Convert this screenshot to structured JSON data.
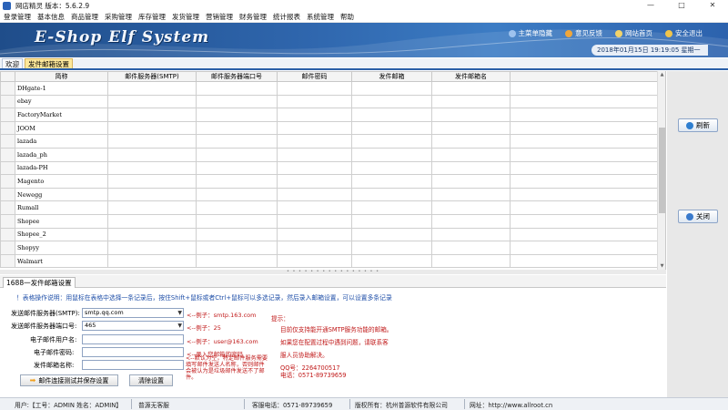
{
  "window": {
    "title": "网店精灵  版本：5.6.2.9",
    "min": "—",
    "max": "□",
    "close": "✕"
  },
  "menu": [
    "登录管理",
    "基本信息",
    "商品管理",
    "采购管理",
    "库存管理",
    "发货管理",
    "营销管理",
    "财务管理",
    "统计报表",
    "系统管理",
    "帮助"
  ],
  "banner": {
    "logo": "E-Shop Elf System",
    "links": [
      "主菜单隐藏",
      "意见反馈",
      "网站首页",
      "安全退出"
    ],
    "datetime": "2018年01月15日 19:19:05 星期一"
  },
  "tabs": [
    "欢迎",
    "发件邮箱设置"
  ],
  "grid": {
    "headers": [
      "简称",
      "邮件服务器(SMTP)",
      "邮件服务器端口号",
      "邮件密码",
      "发件邮箱",
      "发件邮箱名"
    ],
    "rows": [
      [
        "DHgate-1",
        "",
        "",
        "",
        "",
        ""
      ],
      [
        "ebay",
        "",
        "",
        "",
        "",
        ""
      ],
      [
        "FactoryMarket",
        "",
        "",
        "",
        "",
        ""
      ],
      [
        "JOOM",
        "",
        "",
        "",
        "",
        ""
      ],
      [
        "lazada",
        "",
        "",
        "",
        "",
        ""
      ],
      [
        "lazada_ph",
        "",
        "",
        "",
        "",
        ""
      ],
      [
        "lazada-PH",
        "",
        "",
        "",
        "",
        ""
      ],
      [
        "Magento",
        "",
        "",
        "",
        "",
        ""
      ],
      [
        "Newegg",
        "",
        "",
        "",
        "",
        ""
      ],
      [
        "Rumall",
        "",
        "",
        "",
        "",
        ""
      ],
      [
        "Shopee",
        "",
        "",
        "",
        "",
        ""
      ],
      [
        "Shopee_2",
        "",
        "",
        "",
        "",
        ""
      ],
      [
        "Shopyy",
        "",
        "",
        "",
        "",
        ""
      ],
      [
        "Walmart",
        "",
        "",
        "",
        "",
        ""
      ]
    ]
  },
  "side": {
    "refresh": "刷新",
    "close": "关闭"
  },
  "form_tab": "1688一发件邮箱设置",
  "form": {
    "hint": "！表格操作说明：用鼠标在表格中选择一条记录后，按住Shift+鼠标或者Ctrl+鼠标可以多选记录，然后录入邮箱设置，可以设置多条记录",
    "smtp_label": "发送邮件服务器(SMTP):",
    "smtp_value": "smtp.qq.com",
    "smtp_example": "<--例子：smtp.163.com",
    "port_label": "发送邮件服务器端口号:",
    "port_value": "465",
    "port_example": "<--例子：25",
    "user_label": "电子邮件用户名:",
    "user_value": "",
    "user_example": "<--例子：user@163.com",
    "pwd_label": "电子邮件密码:",
    "pwd_value": "",
    "pwd_example": "<--录入您邮箱的密码",
    "sender_label": "发件邮箱名称:",
    "sender_value": "",
    "test_button": "邮件连接测试并保存设置",
    "clear_button": "清除设置",
    "warning": "<--默认为空，特定邮件服务需要填写邮件发送人名称，否则邮件会被认为是垃圾邮件发送不了邮件。"
  },
  "tips": {
    "title": "提示：",
    "line1": "目前仅支持能开通SMTP服务功能的邮箱。",
    "line2": "如果您在配置过程中遇到问题，请联系客",
    "line3": "服人员协助解决。",
    "qq": "QQ号：2264700517",
    "phone": "电话：0571-89739659"
  },
  "status": {
    "user": "用户:【工号：ADMIN  姓名：ADMIN】",
    "support": "普源无客服",
    "service_phone": "客服电话：0571-89739659",
    "copyright": "版权所有：杭州普源软件有限公司",
    "website": "网址：http://www.allroot.cn"
  },
  "colors": {
    "banner": "#2f66ad",
    "tab_active": "#fde89a",
    "hint": "#1f4fa8",
    "warn": "#c01818"
  }
}
